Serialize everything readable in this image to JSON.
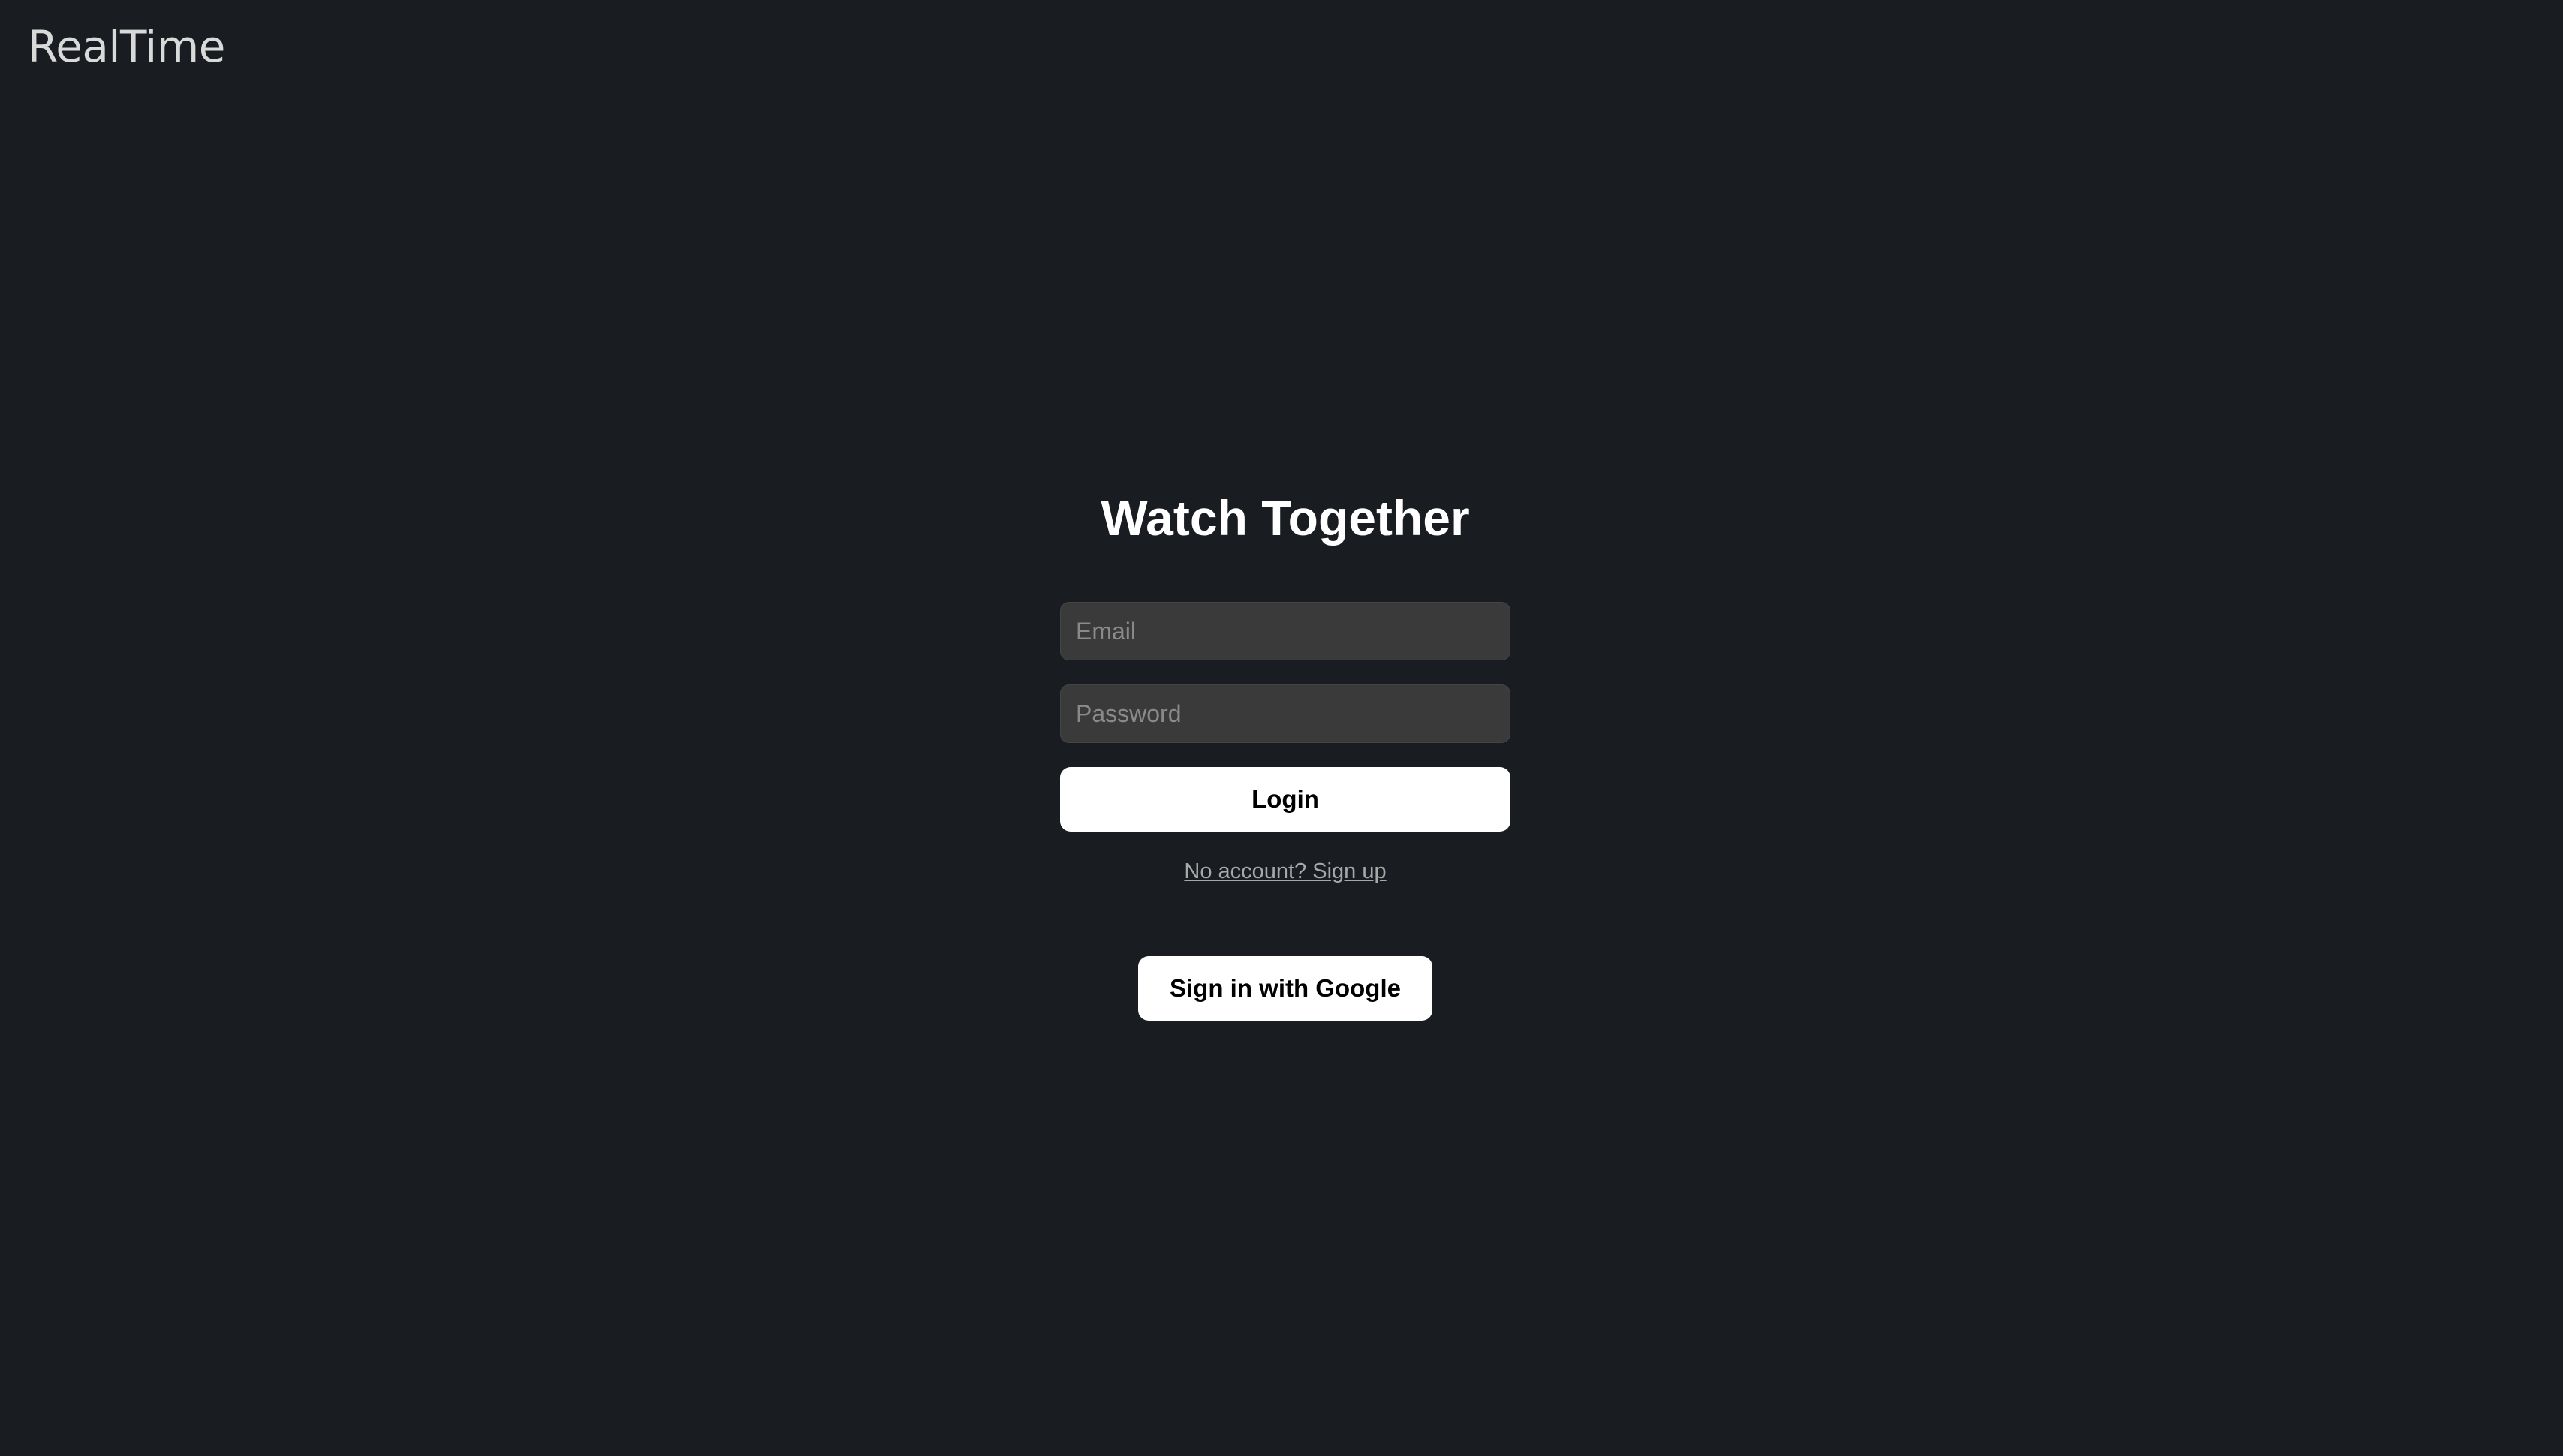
{
  "header": {
    "logo": "RealTime"
  },
  "login": {
    "title": "Watch Together",
    "email_placeholder": "Email",
    "email_value": "",
    "password_placeholder": "Password",
    "password_value": "",
    "login_label": "Login",
    "signup_link": "No account? Sign up"
  },
  "oauth": {
    "google_label": "Sign in with Google"
  },
  "colors": {
    "background": "#191d22",
    "input_background": "#3a3a3a",
    "button_background": "#ffffff",
    "link": "#a8a8a8"
  }
}
